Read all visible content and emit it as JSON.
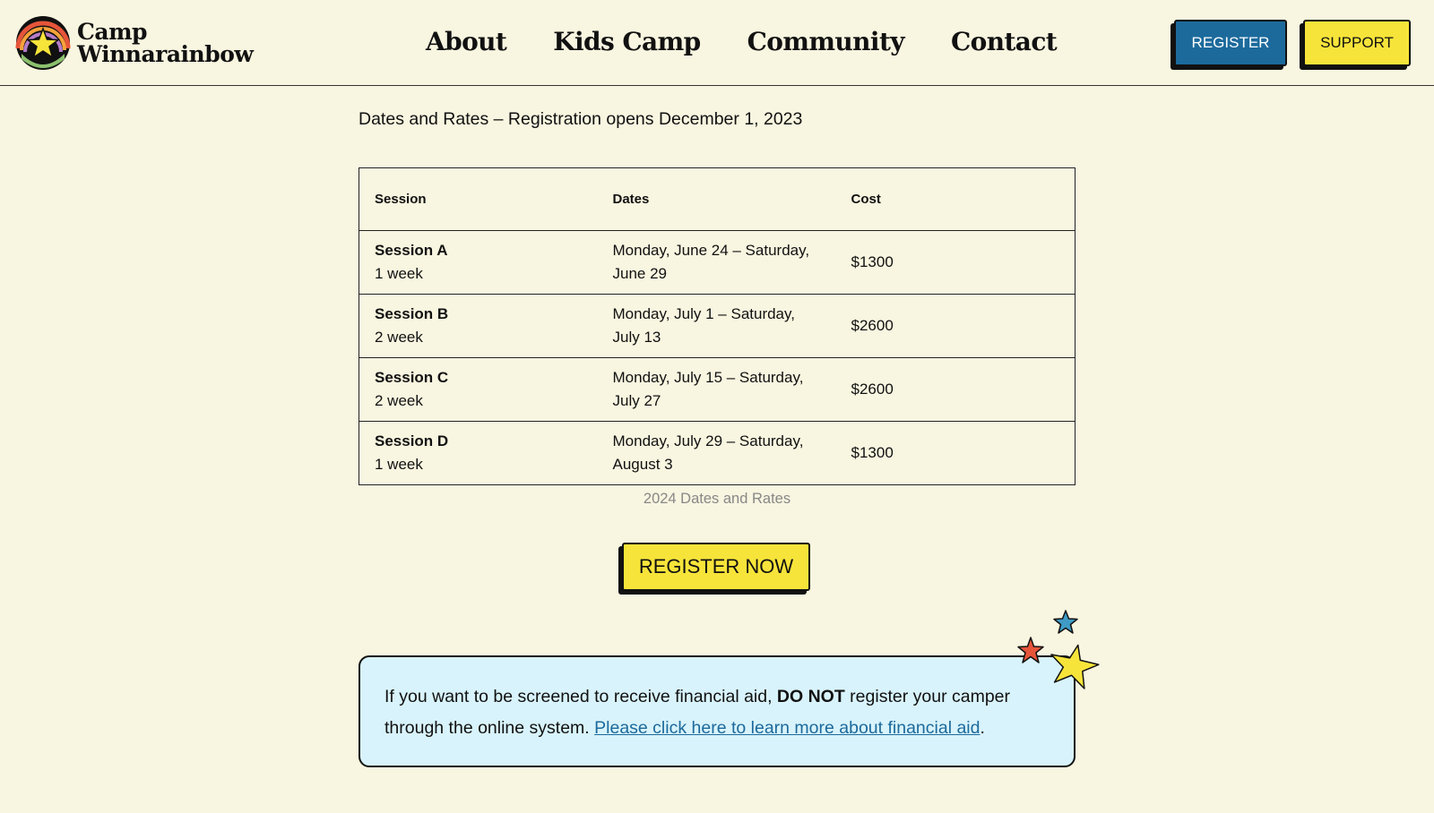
{
  "brand": {
    "line1": "Camp",
    "line2": "Winnarainbow",
    "logo_icon": "rainbow-star-logo-icon"
  },
  "nav": {
    "items": [
      {
        "label": "About"
      },
      {
        "label": "Kids Camp"
      },
      {
        "label": "Community"
      },
      {
        "label": "Contact"
      }
    ]
  },
  "header_buttons": {
    "register_label": "REGISTER",
    "support_label": "SUPPORT"
  },
  "intro": {
    "text": "Dates and Rates – Registration opens December 1, 2023"
  },
  "rates_table": {
    "headers": [
      "Session",
      "Dates",
      "Cost"
    ],
    "rows": [
      {
        "session": "Session A",
        "length": "1 week",
        "dates": "Monday, June 24 – Saturday, June 29",
        "cost": "$1300"
      },
      {
        "session": "Session B",
        "length": "2 week",
        "dates": "Monday, July 1 – Saturday, July 13",
        "cost": "$2600"
      },
      {
        "session": "Session C",
        "length": "2 week",
        "dates": "Monday, July 15 – Saturday, July 27",
        "cost": "$2600"
      },
      {
        "session": "Session D",
        "length": "1 week",
        "dates": "Monday, July 29 – Saturday, August 3",
        "cost": "$1300"
      }
    ],
    "caption": "2024 Dates and Rates"
  },
  "cta": {
    "register_now_label": "REGISTER NOW"
  },
  "financial_aid": {
    "text_before": "If you want to be screened to receive financial aid, ",
    "emphasis": "DO NOT",
    "text_middle": " register your camper through the online system. ",
    "link_text": "Please click here to learn more about financial aid",
    "text_after": "."
  },
  "colors": {
    "background": "#f8f5e0",
    "primary_blue": "#1c6a9c",
    "accent_yellow": "#f7e43a",
    "notice_bg": "#d8f3fb",
    "star_blue": "#3f9bc6",
    "star_red": "#e5553a",
    "star_yellow": "#f7e43a"
  }
}
